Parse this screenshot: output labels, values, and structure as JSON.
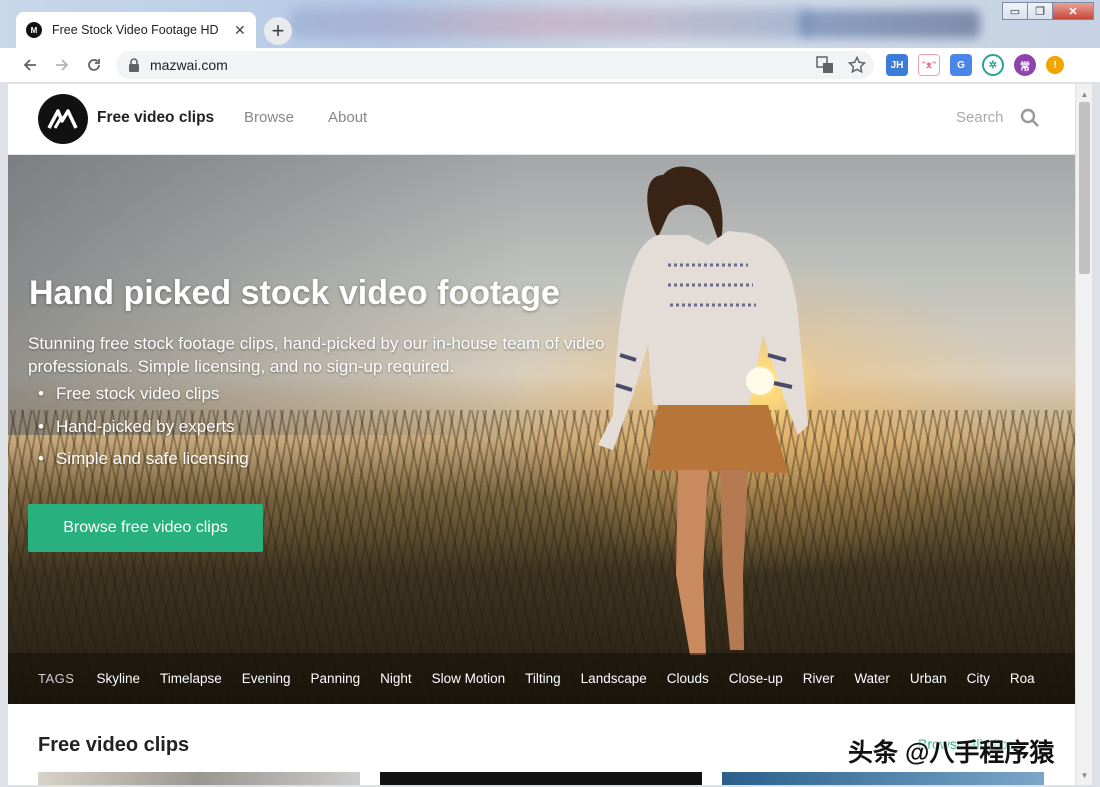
{
  "browser": {
    "tab_title": "Free Stock Video Footage HD",
    "tab_close": "✕",
    "new_tab": "+",
    "url": "mazwai.com",
    "window_controls": {
      "minimize": "▭",
      "restore": "❐",
      "close": "✕"
    },
    "extensions": [
      {
        "label": "JH",
        "color": "#3d7bd9"
      },
      {
        "label": "",
        "color": "#f5c6cf"
      },
      {
        "label": "G",
        "color": "#4a86e8"
      },
      {
        "label": "",
        "color": "#2aa198"
      },
      {
        "label": "常",
        "color": "#8e44ad"
      },
      {
        "label": "!",
        "color": "#f0a500"
      }
    ]
  },
  "site": {
    "brand": "Free video clips",
    "nav": [
      "Browse",
      "About"
    ],
    "search_label": "Search",
    "accent_color": "#28b17f"
  },
  "hero": {
    "title": "Hand picked stock video footage",
    "description": "Stunning free stock footage clips, hand-picked by our in-house team of video professionals. Simple licensing, and no sign-up required.",
    "bullets": [
      "Free stock video clips",
      "Hand-picked by experts",
      "Simple and safe licensing"
    ],
    "cta_label": "Browse free video clips"
  },
  "tags": {
    "label": "TAGS",
    "items": [
      "Skyline",
      "Timelapse",
      "Evening",
      "Panning",
      "Night",
      "Slow Motion",
      "Tilting",
      "Landscape",
      "Clouds",
      "Close-up",
      "River",
      "Water",
      "Urban",
      "City",
      "Roa"
    ]
  },
  "section": {
    "title": "Free video clips",
    "browse_all": "Browse all clips"
  },
  "watermark": "头条 @八手程序猿"
}
